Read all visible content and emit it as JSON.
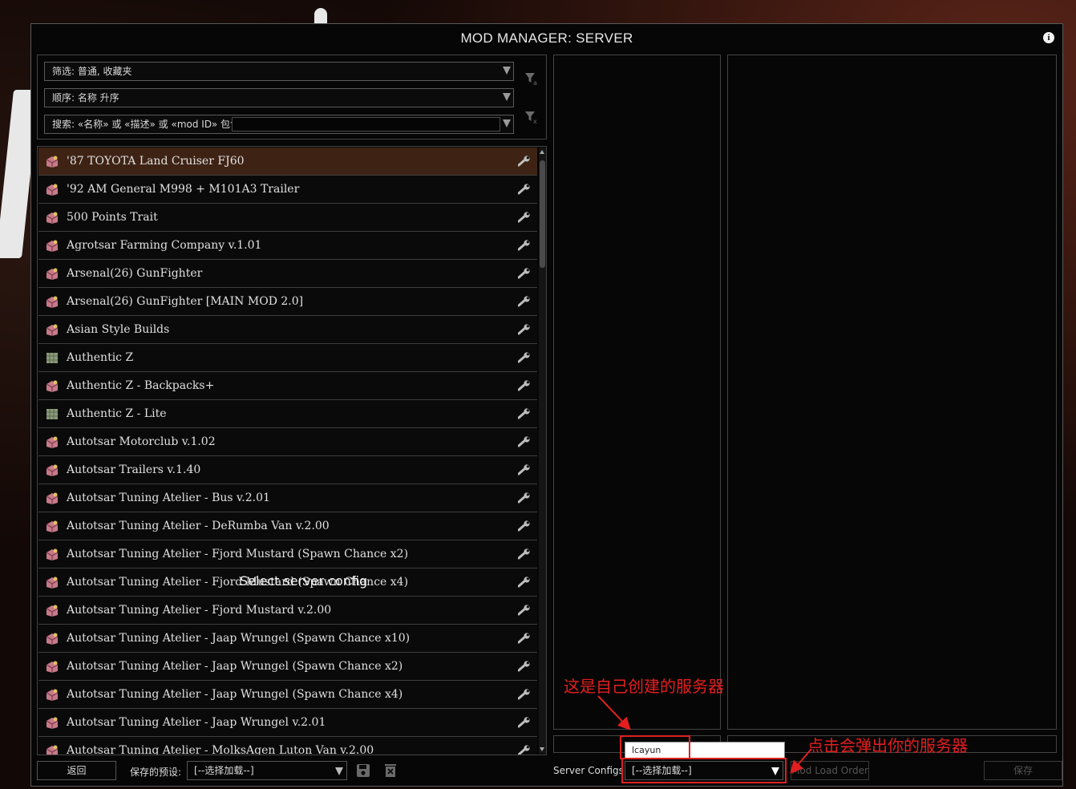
{
  "window": {
    "title": "MOD MANAGER: SERVER"
  },
  "filters": {
    "filter_label": "筛选: 普通, 收藏夹",
    "order_label": "顺序: 名称 升序",
    "search_label": "搜索: «名称» 或 «描述» 或 «mod ID» 包含",
    "search_value": ""
  },
  "mods": [
    {
      "name": "'87 TOYOTA Land Cruiser FJ60",
      "icon": "vehicle-mod-icon",
      "selected": true
    },
    {
      "name": "'92 AM General M998 + M101A3 Trailer",
      "icon": "vehicle-mod-icon"
    },
    {
      "name": "500 Points Trait",
      "icon": "vehicle-mod-icon"
    },
    {
      "name": "Agrotsar Farming Company v.1.01",
      "icon": "vehicle-mod-icon"
    },
    {
      "name": "Arsenal(26) GunFighter",
      "icon": "vehicle-mod-icon"
    },
    {
      "name": "Arsenal(26) GunFighter [MAIN MOD 2.0]",
      "icon": "vehicle-mod-icon"
    },
    {
      "name": "Asian Style Builds",
      "icon": "vehicle-mod-icon"
    },
    {
      "name": "Authentic Z",
      "icon": "map-mod-icon"
    },
    {
      "name": "Authentic Z - Backpacks+",
      "icon": "vehicle-mod-icon"
    },
    {
      "name": "Authentic Z - Lite",
      "icon": "map-mod-icon"
    },
    {
      "name": "Autotsar Motorclub v.1.02",
      "icon": "vehicle-mod-icon"
    },
    {
      "name": "Autotsar Trailers v.1.40",
      "icon": "vehicle-mod-icon"
    },
    {
      "name": "Autotsar Tuning Atelier - Bus v.2.01",
      "icon": "vehicle-mod-icon"
    },
    {
      "name": "Autotsar Tuning Atelier - DeRumba Van v.2.00",
      "icon": "vehicle-mod-icon"
    },
    {
      "name": "Autotsar Tuning Atelier - Fjord Mustard (Spawn Chance x2)",
      "icon": "vehicle-mod-icon"
    },
    {
      "name": "Autotsar Tuning Atelier - Fjord Mustard (Spawn Chance x4)",
      "icon": "vehicle-mod-icon"
    },
    {
      "name": "Autotsar Tuning Atelier - Fjord Mustard v.2.00",
      "icon": "vehicle-mod-icon"
    },
    {
      "name": "Autotsar Tuning Atelier - Jaap Wrungel (Spawn Chance x10)",
      "icon": "vehicle-mod-icon"
    },
    {
      "name": "Autotsar Tuning Atelier - Jaap Wrungel (Spawn Chance x2)",
      "icon": "vehicle-mod-icon"
    },
    {
      "name": "Autotsar Tuning Atelier - Jaap Wrungel (Spawn Chance x4)",
      "icon": "vehicle-mod-icon"
    },
    {
      "name": "Autotsar Tuning Atelier - Jaap Wrungel v.2.01",
      "icon": "vehicle-mod-icon"
    },
    {
      "name": "Autotsar Tuning Atelier - MolksAgen Luton Van v.2.00",
      "icon": "vehicle-mod-icon"
    }
  ],
  "overlay_caption": "Select server config",
  "footer": {
    "back_label": "返回",
    "saved_presets_label": "保存的预设:",
    "preset_value": "[--选择加载--]",
    "server_configs_label": "Server Configs:",
    "server_config_value": "[--选择加载--]",
    "mod_load_order_label": "Mod Load Order",
    "save_label": "保存"
  },
  "server_popup": {
    "items": [
      "lcayun"
    ]
  },
  "annotations": {
    "created_server": "这是自己创建的服务器",
    "click_popup": "点击会弹出你的服务器"
  },
  "colors": {
    "annotation": "#e41e1e",
    "selected_row": "#3e2314"
  }
}
